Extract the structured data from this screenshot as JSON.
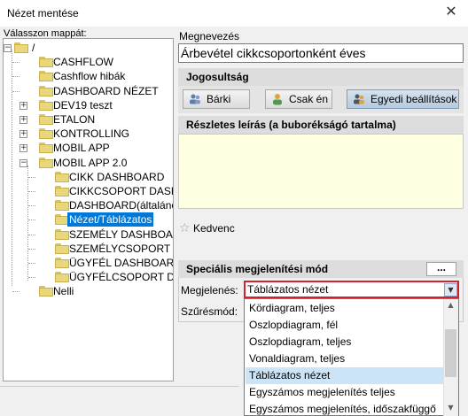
{
  "window": {
    "title": "Nézet mentése",
    "close": "✕"
  },
  "tree": {
    "label": "Válasszon mappát:",
    "items": [
      {
        "label": "/",
        "depth": 0,
        "expander": "−"
      },
      {
        "label": "CASHFLOW",
        "depth": 1
      },
      {
        "label": "Cashflow hibák",
        "depth": 1
      },
      {
        "label": "DASHBOARD NÉZET",
        "depth": 1
      },
      {
        "label": "DEV19 teszt",
        "depth": 1,
        "expander": "+"
      },
      {
        "label": "ETALON",
        "depth": 1,
        "expander": "+"
      },
      {
        "label": "KONTROLLING",
        "depth": 1,
        "expander": "+"
      },
      {
        "label": "MOBIL APP",
        "depth": 1,
        "expander": "+"
      },
      {
        "label": "MOBIL APP 2.0",
        "depth": 1,
        "expander": "−"
      },
      {
        "label": "CIKK DASHBOARD",
        "depth": 2
      },
      {
        "label": "CIKKCSOPORT DASHB",
        "depth": 2
      },
      {
        "label": "DASHBOARD(általános",
        "depth": 2
      },
      {
        "label": "Nézet/Táblázatos",
        "depth": 2,
        "selected": true
      },
      {
        "label": "SZEMÉLY DASHBOARI",
        "depth": 2
      },
      {
        "label": "SZEMÉLYCSOPORT DA",
        "depth": 2
      },
      {
        "label": "ÜGYFÉL DASHBOARD",
        "depth": 2
      },
      {
        "label": "ÜGYFÉLCSOPORT DAS",
        "depth": 2
      },
      {
        "label": "Nelli",
        "depth": 1
      }
    ]
  },
  "name": {
    "label": "Megnevezés",
    "value": "Árbevétel cikkcsoportonként éves"
  },
  "permissions": {
    "heading": "Jogosultság",
    "buttons": [
      {
        "label": "Bárki",
        "icon": "users-icon"
      },
      {
        "label": "Csak én",
        "icon": "user-icon"
      },
      {
        "label": "Egyedi beállítások",
        "icon": "custom-users-icon",
        "active": true
      }
    ]
  },
  "description": {
    "heading": "Részletes leírás (a buborékságó tartalma)",
    "value": ""
  },
  "favorite": {
    "label": "Kedvenc",
    "icon": "star-icon",
    "checked": false
  },
  "special": {
    "heading": "Speciális megjelenítési mód",
    "more_button": "...",
    "display_label": "Megjelenés:",
    "filter_label": "Szűrésmód:",
    "selected": "Táblázatos nézet",
    "options": [
      "Kördiagram, teljes",
      "Oszlopdiagram, fél",
      "Oszlopdiagram, teljes",
      "Vonaldiagram, teljes",
      "Táblázatos nézet",
      "Egyszámos megjelenítés teljes",
      "Egyszámos megjelenítés, időszakfüggő"
    ]
  },
  "colors": {
    "selection": "#0078d7",
    "highlight_border": "#d2232a",
    "description_bg": "#ffffe1"
  }
}
